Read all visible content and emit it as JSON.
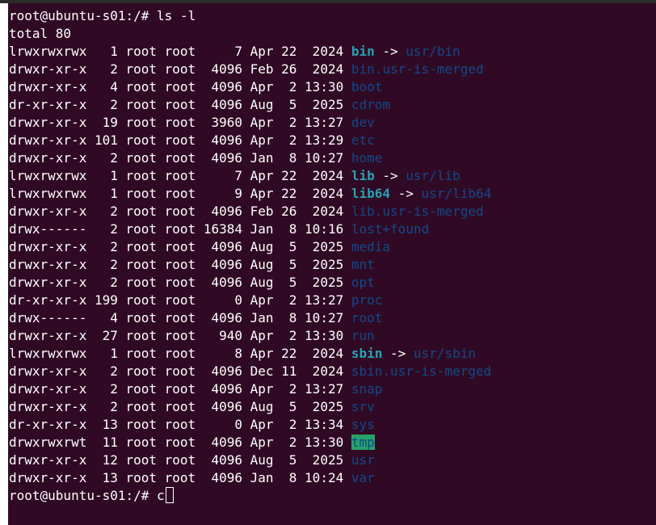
{
  "prompt": "root@ubuntu-s01:/# ",
  "command": "ls -l",
  "total_line": "total 80",
  "entries": [
    {
      "perm": "lrwxrwxrwx",
      "meta": "   1 root root     7 Apr 22  2024 ",
      "name": "bin",
      "kind": "link",
      "arrow": " -> ",
      "target": "usr/bin"
    },
    {
      "perm": "drwxr-xr-x",
      "meta": "   2 root root  4096 Feb 26  2024 ",
      "name": "bin.usr-is-merged",
      "kind": "dir"
    },
    {
      "perm": "drwxr-xr-x",
      "meta": "   4 root root  4096 Apr  2 13:30 ",
      "name": "boot",
      "kind": "dir"
    },
    {
      "perm": "dr-xr-xr-x",
      "meta": "   2 root root  4096 Aug  5  2025 ",
      "name": "cdrom",
      "kind": "dir"
    },
    {
      "perm": "drwxr-xr-x",
      "meta": "  19 root root  3960 Apr  2 13:27 ",
      "name": "dev",
      "kind": "dir"
    },
    {
      "perm": "drwxr-xr-x",
      "meta": " 101 root root  4096 Apr  2 13:29 ",
      "name": "etc",
      "kind": "dir"
    },
    {
      "perm": "drwxr-xr-x",
      "meta": "   2 root root  4096 Jan  8 10:27 ",
      "name": "home",
      "kind": "dir"
    },
    {
      "perm": "lrwxrwxrwx",
      "meta": "   1 root root     7 Apr 22  2024 ",
      "name": "lib",
      "kind": "link",
      "arrow": " -> ",
      "target": "usr/lib"
    },
    {
      "perm": "lrwxrwxrwx",
      "meta": "   1 root root     9 Apr 22  2024 ",
      "name": "lib64",
      "kind": "link",
      "arrow": " -> ",
      "target": "usr/lib64"
    },
    {
      "perm": "drwxr-xr-x",
      "meta": "   2 root root  4096 Feb 26  2024 ",
      "name": "lib.usr-is-merged",
      "kind": "dir"
    },
    {
      "perm": "drwx------",
      "meta": "   2 root root 16384 Jan  8 10:16 ",
      "name": "lost+found",
      "kind": "dir"
    },
    {
      "perm": "drwxr-xr-x",
      "meta": "   2 root root  4096 Aug  5  2025 ",
      "name": "media",
      "kind": "dir"
    },
    {
      "perm": "drwxr-xr-x",
      "meta": "   2 root root  4096 Aug  5  2025 ",
      "name": "mnt",
      "kind": "dir"
    },
    {
      "perm": "drwxr-xr-x",
      "meta": "   2 root root  4096 Aug  5  2025 ",
      "name": "opt",
      "kind": "dir"
    },
    {
      "perm": "dr-xr-xr-x",
      "meta": " 199 root root     0 Apr  2 13:27 ",
      "name": "proc",
      "kind": "dir"
    },
    {
      "perm": "drwx------",
      "meta": "   4 root root  4096 Jan  8 10:27 ",
      "name": "root",
      "kind": "dir"
    },
    {
      "perm": "drwxr-xr-x",
      "meta": "  27 root root   940 Apr  2 13:30 ",
      "name": "run",
      "kind": "dir"
    },
    {
      "perm": "lrwxrwxrwx",
      "meta": "   1 root root     8 Apr 22  2024 ",
      "name": "sbin",
      "kind": "link",
      "arrow": " -> ",
      "target": "usr/sbin"
    },
    {
      "perm": "drwxr-xr-x",
      "meta": "   2 root root  4096 Dec 11  2024 ",
      "name": "sbin.usr-is-merged",
      "kind": "dir"
    },
    {
      "perm": "drwxr-xr-x",
      "meta": "   2 root root  4096 Apr  2 13:27 ",
      "name": "snap",
      "kind": "dir"
    },
    {
      "perm": "drwxr-xr-x",
      "meta": "   2 root root  4096 Aug  5  2025 ",
      "name": "srv",
      "kind": "dir"
    },
    {
      "perm": "dr-xr-xr-x",
      "meta": "  13 root root     0 Apr  2 13:34 ",
      "name": "sys",
      "kind": "dir"
    },
    {
      "perm": "drwxrwxrwt",
      "meta": "  11 root root  4096 Apr  2 13:30 ",
      "name": "tmp",
      "kind": "sticky"
    },
    {
      "perm": "drwxr-xr-x",
      "meta": "  12 root root  4096 Aug  5  2025 ",
      "name": "usr",
      "kind": "dir"
    },
    {
      "perm": "drwxr-xr-x",
      "meta": "  13 root root  4096 Jan  8 10:24 ",
      "name": "var",
      "kind": "dir"
    }
  ],
  "current_input": "c",
  "colors": {
    "background": "#300a24",
    "text": "#ffffff",
    "directory": "#12488b",
    "symlink": "#2aa1b3",
    "sticky_bg": "#26a269"
  }
}
